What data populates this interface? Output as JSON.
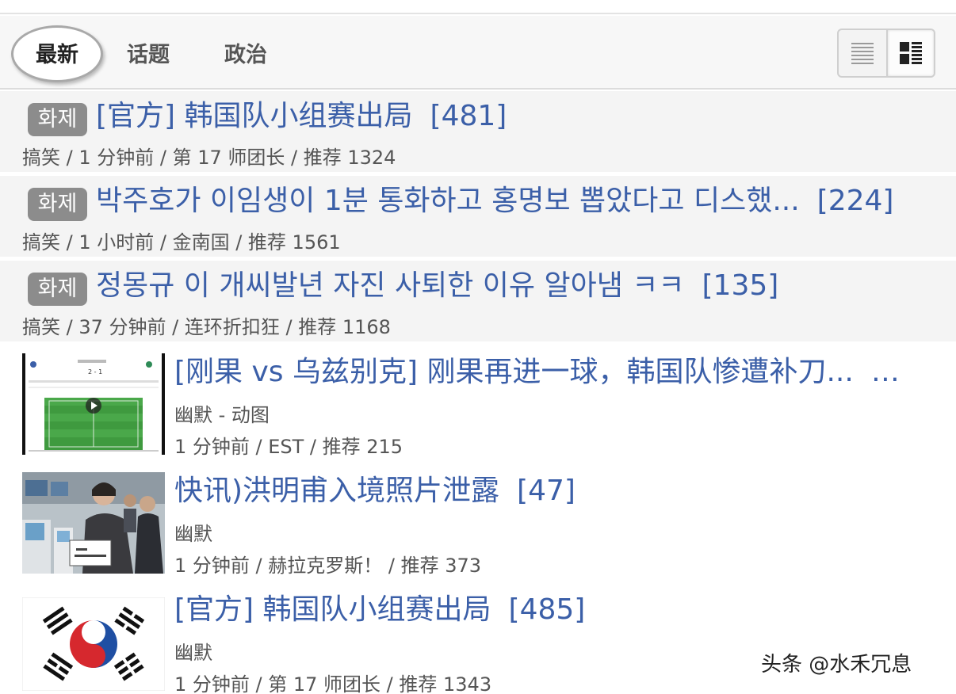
{
  "tabs": [
    {
      "label": "最新",
      "active": true
    },
    {
      "label": "话题"
    },
    {
      "label": "政治"
    }
  ],
  "view_toggle": {
    "list_icon": "list-view-icon",
    "thumb_icon": "thumbnail-view-icon",
    "selected": "thumbnail"
  },
  "text_posts": [
    {
      "badge": "화제",
      "title": "[官方] 韩国队小组赛出局",
      "count": "[481]",
      "meta": "搞笑 / 1 分钟前 / 第 17 师团长 / 推荐 1324"
    },
    {
      "badge": "화제",
      "title": "박주호가 이임생이 1분 통화하고 홍명보 뽑았다고 디스했...",
      "count": "[224]",
      "meta": "搞笑 / 1 小时前 / 金南国 / 推荐 1561"
    },
    {
      "badge": "화제",
      "title": "정몽규 이 개씨발년 자진 사퇴한 이유 알아냄 ㅋㅋ",
      "count": "[135]",
      "meta": "搞笑 / 37 分钟前 / 连环折扣狂 / 推荐 1168"
    }
  ],
  "image_posts": [
    {
      "thumb": "football-match-screenshot",
      "title": "[刚果 vs 乌兹别克] 刚果再进一球，韩国队惨遭补刀...",
      "count": "…",
      "category": "幽默 - 动图",
      "meta": "1 分钟前 / EST / 推荐 215"
    },
    {
      "thumb": "airport-photo",
      "title": "快讯)洪明甫入境照片泄露",
      "count": "[47]",
      "category": "幽默",
      "meta": "1 分钟前 / 赫拉克罗斯！ / 推荐 373"
    },
    {
      "thumb": "korean-flag",
      "title": "[官方] 韩国队小组赛出局",
      "count": "[485]",
      "category": "幽默",
      "meta": "1 分钟前 / 第 17 师团长 / 推荐 1343"
    }
  ],
  "watermark": "头条 @水禾冗息",
  "colors": {
    "link": "#3b5fa8",
    "badge": "#8c8c8c",
    "row_bg": "#f4f4f4"
  }
}
